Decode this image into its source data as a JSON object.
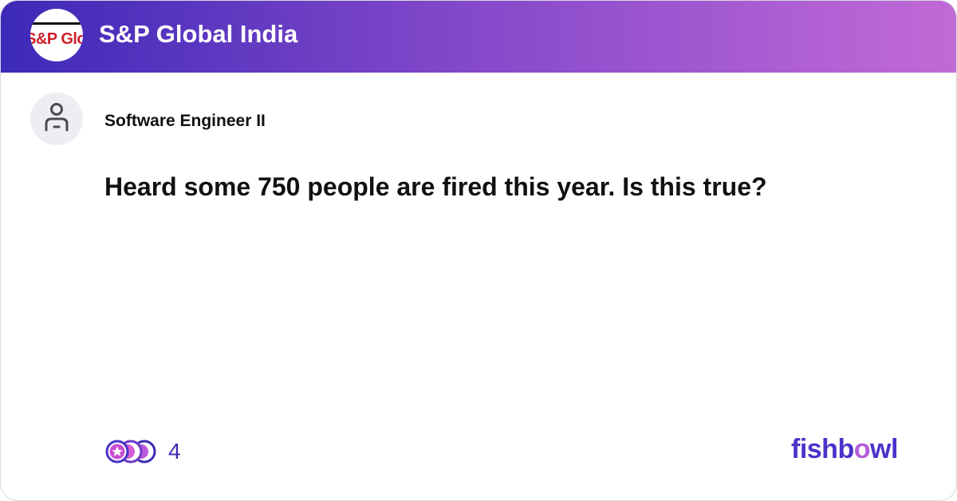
{
  "header": {
    "logo_text": "S&P Global",
    "company_name": "S&P Global India"
  },
  "post": {
    "author_role": "Software Engineer II",
    "question": "Heard some 750 people are fired this year. Is this true?"
  },
  "footer": {
    "reaction_count": "4",
    "brand_parts": {
      "before": "fishb",
      "accent": "o",
      "after": "wl"
    },
    "icons": [
      "reaction-icons",
      "person-icon"
    ]
  },
  "colors": {
    "header_gradient": [
      "#3d29b8",
      "#7f46c9",
      "#c26ad7"
    ],
    "accent": "#4a33c9",
    "brand_highlight": "#b55fd9"
  }
}
